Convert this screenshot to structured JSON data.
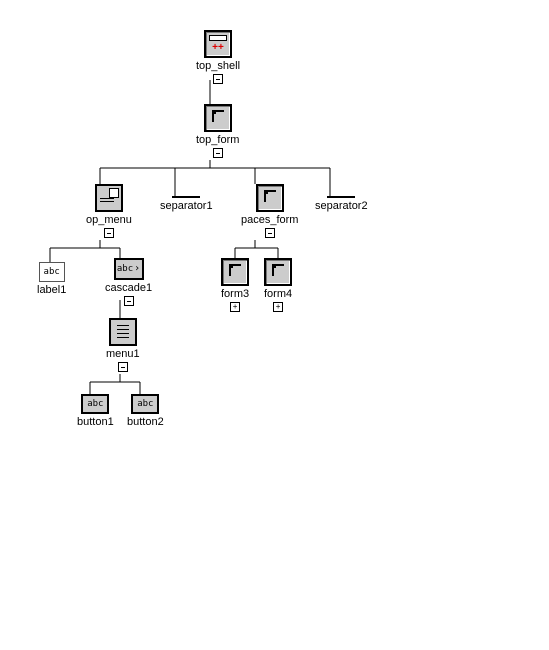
{
  "tree": {
    "root": {
      "name": "top_shell",
      "icon": "shell",
      "children": [
        {
          "name": "top_form",
          "icon": "form",
          "children": [
            {
              "name": "op_menu",
              "icon": "opmenu",
              "children": [
                {
                  "name": "label1",
                  "icon": "abc",
                  "children": []
                },
                {
                  "name": "cascade1",
                  "icon": "abc-arrow",
                  "children": [
                    {
                      "name": "menu1",
                      "icon": "menu",
                      "children": [
                        {
                          "name": "button1",
                          "icon": "abc",
                          "children": []
                        },
                        {
                          "name": "button2",
                          "icon": "abc",
                          "children": []
                        }
                      ]
                    }
                  ]
                }
              ]
            },
            {
              "name": "separator1",
              "icon": "sep",
              "children": []
            },
            {
              "name": "paces_form",
              "icon": "form",
              "children": [
                {
                  "name": "form3",
                  "icon": "form",
                  "collapsed": true,
                  "children": []
                },
                {
                  "name": "form4",
                  "icon": "form",
                  "collapsed": true,
                  "children": []
                }
              ]
            },
            {
              "name": "separator2",
              "icon": "sep",
              "children": []
            }
          ]
        }
      ]
    }
  },
  "labels": {
    "top_shell": "top_shell",
    "top_form": "top_form",
    "op_menu": "op_menu",
    "separator1": "separator1",
    "paces_form": "paces_form",
    "separator2": "separator2",
    "label1": "label1",
    "cascade1": "cascade1",
    "menu1": "menu1",
    "button1": "button1",
    "button2": "button2",
    "form3": "form3",
    "form4": "form4"
  },
  "glyphs": {
    "abc": "abc",
    "abcarrow": "abc"
  }
}
